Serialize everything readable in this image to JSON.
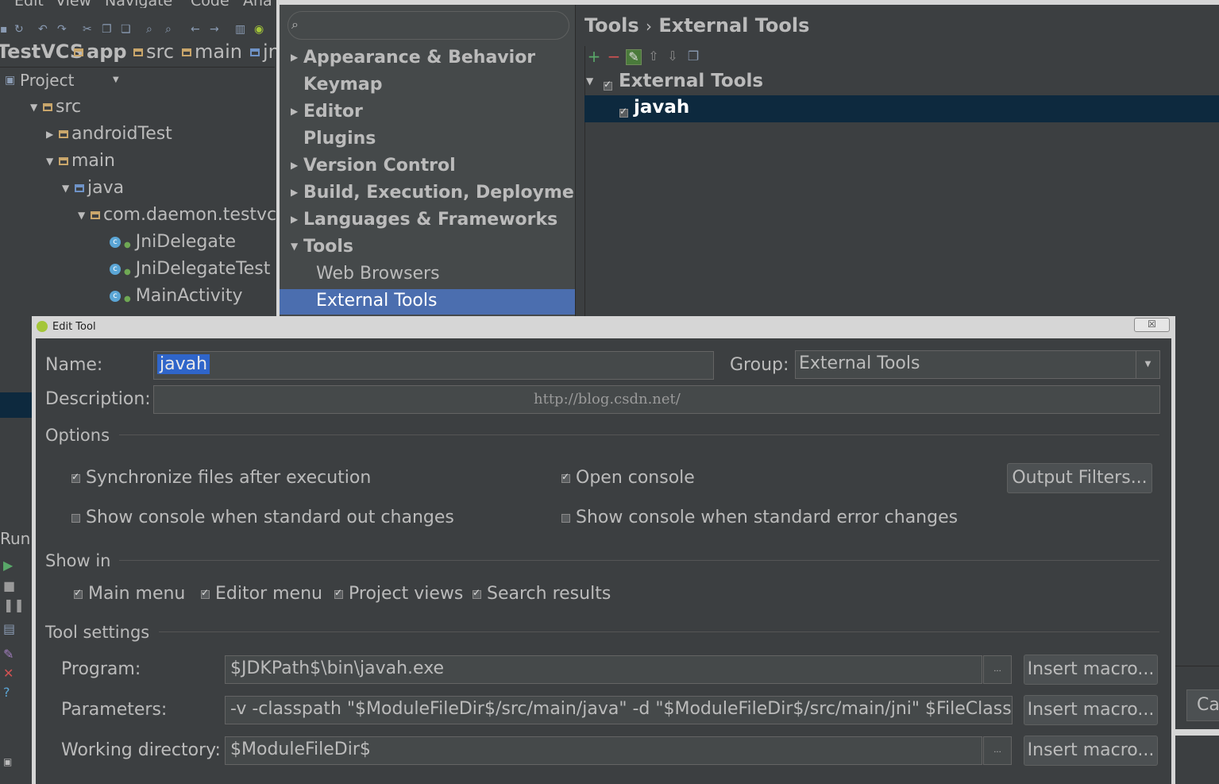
{
  "ide": {
    "menu": [
      "Edit",
      "View",
      "Navigate",
      "Code",
      "Ana"
    ],
    "breadcrumbs": [
      "TestVCS",
      "app",
      "src",
      "main",
      "jni"
    ],
    "project_view": "Project",
    "tree": [
      {
        "label": "src",
        "kind": "folder",
        "expanded": true
      },
      {
        "label": "androidTest",
        "kind": "folder",
        "expanded": false
      },
      {
        "label": "main",
        "kind": "folder",
        "expanded": true
      },
      {
        "label": "java",
        "kind": "folder",
        "expanded": true
      },
      {
        "label": "com.daemon.testvcs",
        "kind": "package",
        "expanded": true
      },
      {
        "label": "JniDelegate",
        "kind": "class"
      },
      {
        "label": "JniDelegateTest",
        "kind": "class"
      },
      {
        "label": "MainActivity",
        "kind": "class"
      }
    ],
    "run_label": "Run"
  },
  "settings": {
    "search_placeholder": "",
    "nav": [
      {
        "label": "Appearance & Behavior",
        "arrow": "collapsed",
        "bold": true
      },
      {
        "label": "Keymap",
        "arrow": "none",
        "bold": true
      },
      {
        "label": "Editor",
        "arrow": "collapsed",
        "bold": true
      },
      {
        "label": "Plugins",
        "arrow": "none",
        "bold": true
      },
      {
        "label": "Version Control",
        "arrow": "collapsed",
        "bold": true
      },
      {
        "label": "Build, Execution, Deployment",
        "arrow": "collapsed",
        "bold": true
      },
      {
        "label": "Languages & Frameworks",
        "arrow": "collapsed",
        "bold": true
      },
      {
        "label": "Tools",
        "arrow": "expanded",
        "bold": true
      },
      {
        "label": "Web Browsers",
        "arrow": "none",
        "bold": false
      },
      {
        "label": "External Tools",
        "arrow": "none",
        "bold": false,
        "selected": true
      }
    ],
    "breadcrumb_parent": "Tools",
    "breadcrumb_sep": "›",
    "breadcrumb_current": "External Tools",
    "toolbar_icons": [
      "add-icon",
      "remove-icon",
      "edit-icon",
      "move-up-icon",
      "move-down-icon",
      "copy-icon"
    ],
    "group_label": "External Tools",
    "tool_label": "javah",
    "cancel_label": "Ca"
  },
  "edit_tool": {
    "title": "Edit Tool",
    "name_label": "Name:",
    "name_value": "javah",
    "group_label": "Group:",
    "group_value": "External Tools",
    "description_label": "Description:",
    "description_value": "",
    "watermark": "http://blog.csdn.net/",
    "options_title": "Options",
    "opt_sync": {
      "label": "Synchronize files after execution",
      "checked": true
    },
    "opt_open_console": {
      "label": "Open console",
      "checked": true
    },
    "opt_show_out": {
      "label": "Show console when standard out changes",
      "checked": false
    },
    "opt_show_err": {
      "label": "Show console when standard error changes",
      "checked": false
    },
    "output_filters_label": "Output Filters...",
    "show_in_title": "Show in",
    "show_in": [
      {
        "label": "Main menu",
        "checked": true
      },
      {
        "label": "Editor menu",
        "checked": true
      },
      {
        "label": "Project views",
        "checked": true
      },
      {
        "label": "Search results",
        "checked": true
      }
    ],
    "tool_settings_title": "Tool settings",
    "program_label": "Program:",
    "program_value": "$JDKPath$\\bin\\javah.exe",
    "parameters_label": "Parameters:",
    "parameters_value": "-v -classpath \"$ModuleFileDir$/src/main/java\" -d \"$ModuleFileDir$/src/main/jni\" $FileClass$",
    "working_dir_label": "Working directory:",
    "working_dir_value": "$ModuleFileDir$",
    "insert_macro_label": "Insert macro...",
    "browse_label": "..."
  }
}
